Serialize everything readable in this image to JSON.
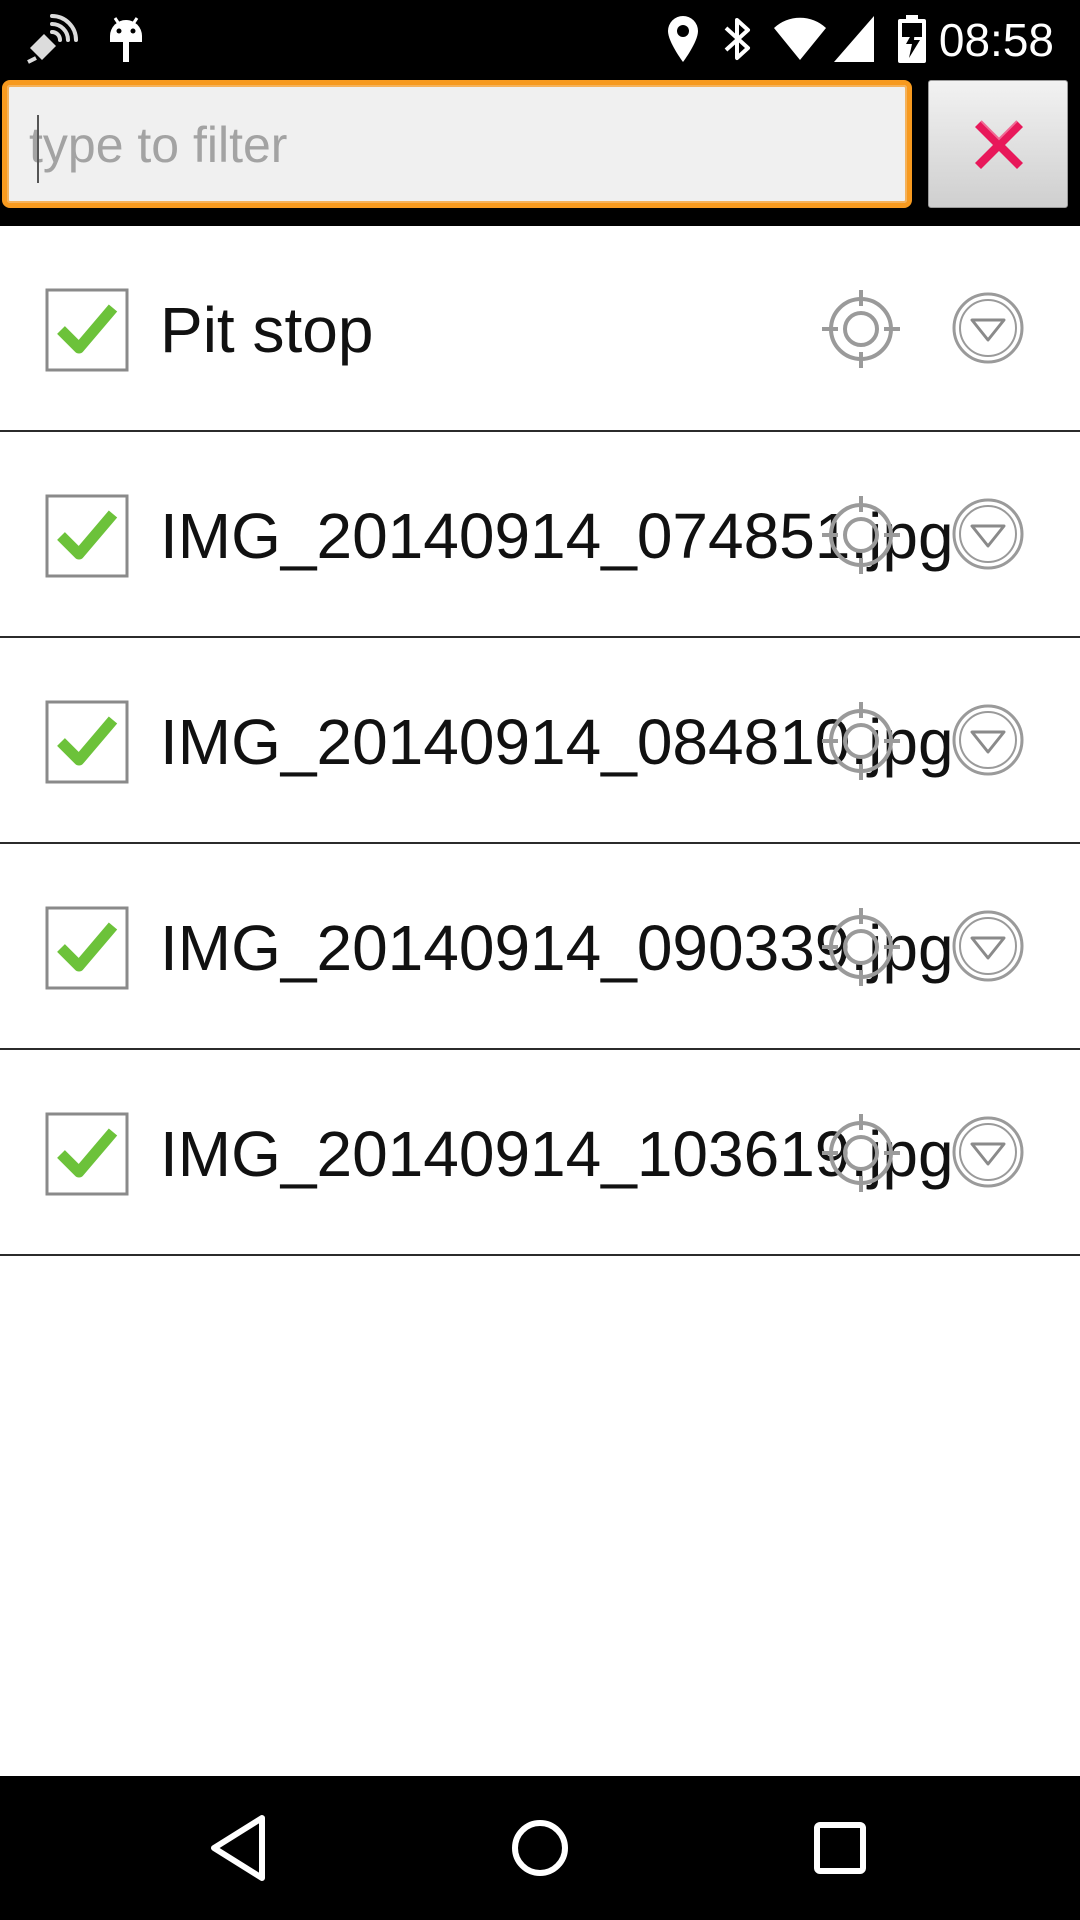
{
  "status_bar": {
    "time": "08:58",
    "icons": [
      "satellite-signal-icon",
      "android-debug-icon",
      "location-icon",
      "bluetooth-icon",
      "wifi-icon",
      "cell-signal-icon",
      "battery-charging-icon"
    ]
  },
  "filter": {
    "placeholder": "type to filter",
    "value": "",
    "clear_icon": "close-x-icon",
    "accent_color": "#f79a1f",
    "clear_color": "#e8185a"
  },
  "items": [
    {
      "label": "Pit stop",
      "checked": true
    },
    {
      "label": "IMG_20140914_074851.jpg",
      "checked": true
    },
    {
      "label": "IMG_20140914_084810.jpg",
      "checked": true
    },
    {
      "label": "IMG_20140914_090339.jpg",
      "checked": true
    },
    {
      "label": "IMG_20140914_103619.jpg",
      "checked": true
    }
  ],
  "row_icons": {
    "target": "crosshair-target-icon",
    "menu": "dropdown-circle-icon",
    "check_color": "#6cc23a"
  },
  "nav_bar": {
    "back": "back-triangle-icon",
    "home": "home-circle-icon",
    "recents": "recents-square-icon"
  }
}
